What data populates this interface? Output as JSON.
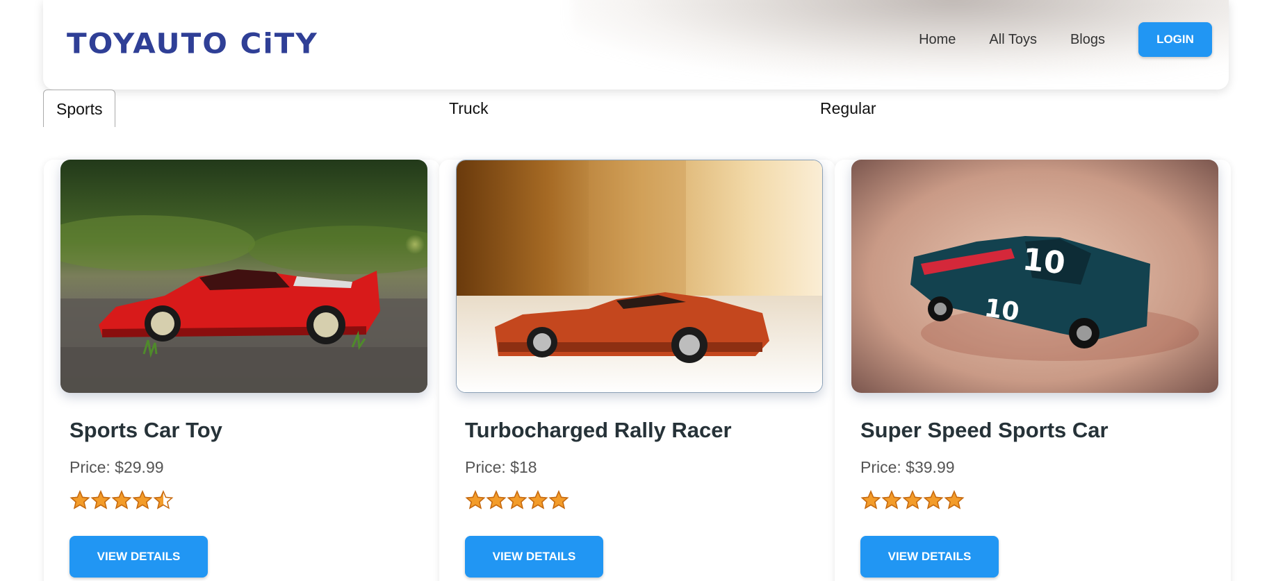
{
  "brand": {
    "logo_text": "TOYAUTO CiTY",
    "logo_color": "#2f3f96"
  },
  "nav": {
    "links": [
      "Home",
      "All Toys",
      "Blogs"
    ],
    "login_label": "LOGIN"
  },
  "tabs": [
    {
      "label": "Sports",
      "active": true
    },
    {
      "label": "Truck",
      "active": false
    },
    {
      "label": "Regular",
      "active": false
    }
  ],
  "products": [
    {
      "title": "Sports Car Toy",
      "price": "Price: $29.99",
      "rating": 4.5,
      "button": "VIEW DETAILS",
      "image_desc": "red-sports-car-photo"
    },
    {
      "title": "Turbocharged Rally Racer",
      "price": "Price: $18",
      "rating": 5,
      "button": "VIEW DETAILS",
      "image_desc": "orange-muscle-car-photo"
    },
    {
      "title": "Super Speed Sports Car",
      "price": "Price: $39.99",
      "rating": 5,
      "button": "VIEW DETAILS",
      "image_desc": "blue-race-car-photo"
    }
  ],
  "colors": {
    "accent": "#2196f3",
    "star": "#f39c2a",
    "star_outline": "#c66a10"
  }
}
